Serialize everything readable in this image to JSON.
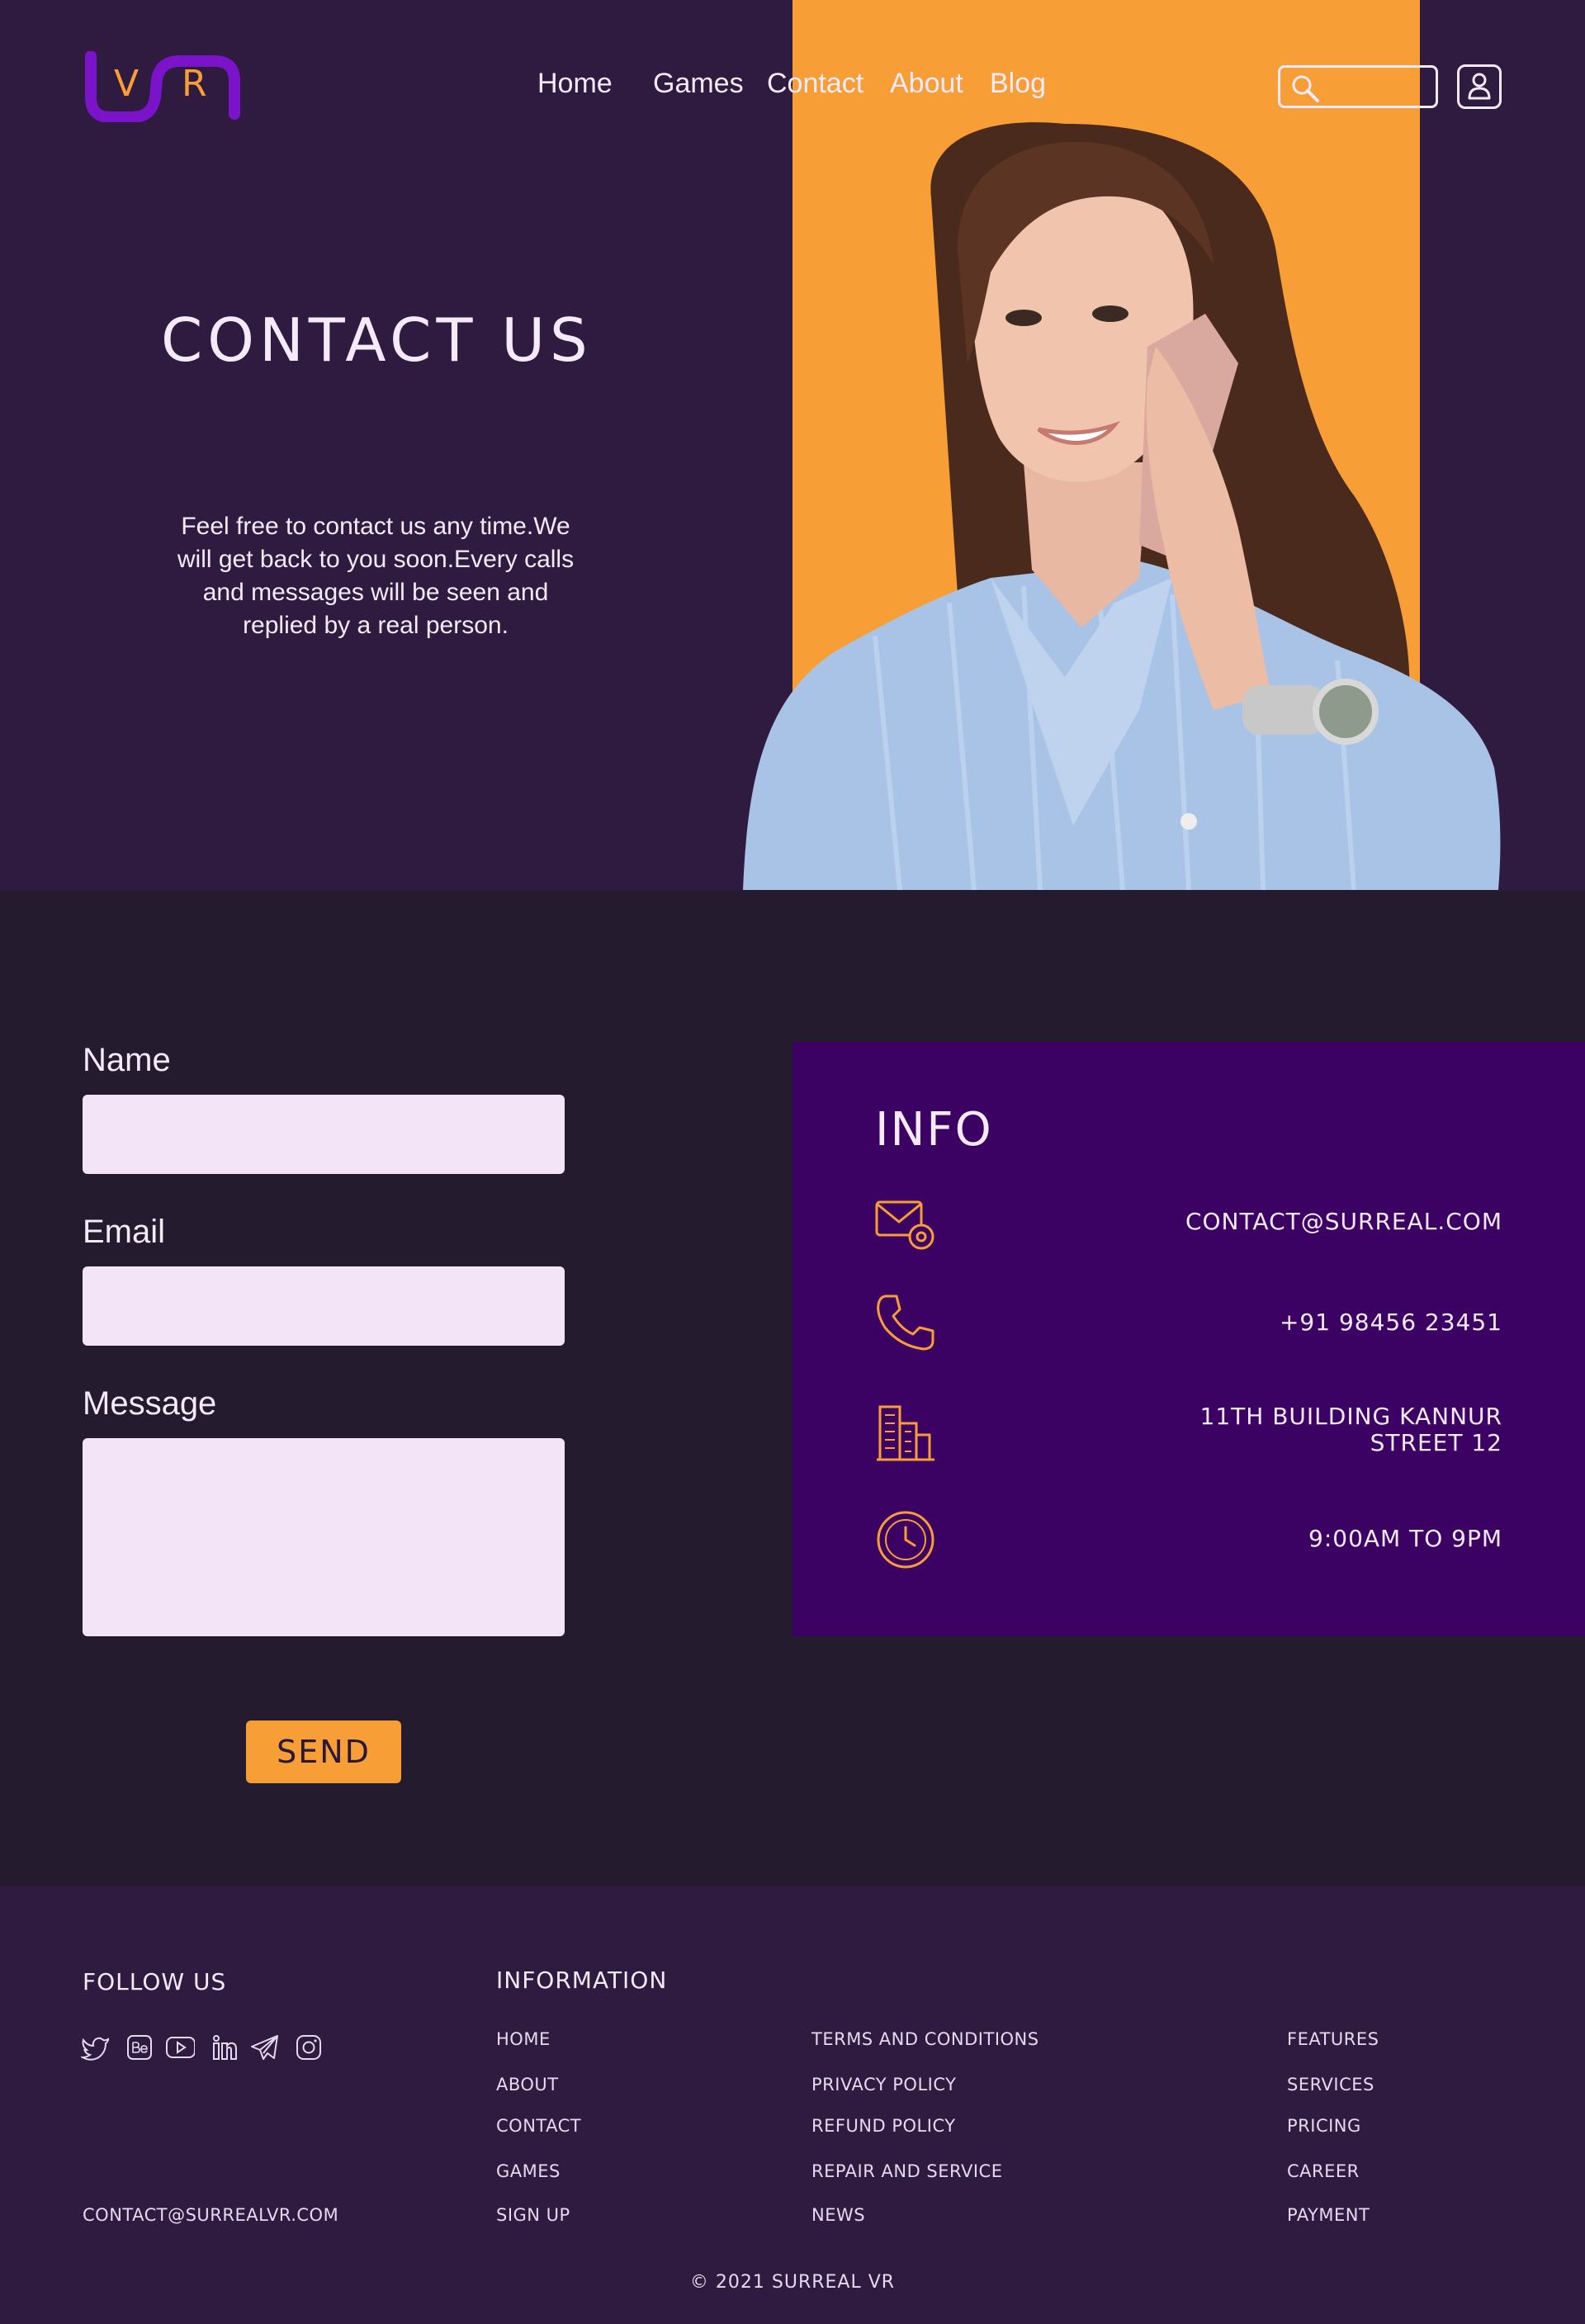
{
  "brand": {
    "letter_1": "V",
    "letter_2": "R",
    "logo_color": "#7a13c9",
    "accent_color": "#f79e36"
  },
  "nav": {
    "home": "Home",
    "games": "Games",
    "contact": "Contact",
    "about": "About",
    "blog": "Blog"
  },
  "search": {
    "placeholder": ""
  },
  "hero": {
    "title": "CONTACT US",
    "text": "Feel free to contact us any time.We will get back to you soon.Every calls and messages will be seen and replied by a real person."
  },
  "form": {
    "name_label": "Name",
    "email_label": "Email",
    "message_label": "Message",
    "send_label": "SEND"
  },
  "info": {
    "title": "INFO",
    "email": "CONTACT@SURREAL.COM",
    "phone": "+91 98456 23451",
    "address_line1": "11TH BUILDING KANNUR",
    "address_line2": "STREET 12",
    "hours": "9:00AM TO 9PM"
  },
  "footer": {
    "follow_title": "FOLLOW US",
    "info_title": "INFORMATION",
    "email": "CONTACT@SURREALVR.COM",
    "col1": [
      "HOME",
      "ABOUT",
      "CONTACT",
      "GAMES",
      "SIGN UP"
    ],
    "col2": [
      "TERMS AND CONDITIONS",
      "PRIVACY POLICY",
      "REFUND POLICY",
      "REPAIR AND SERVICE",
      "NEWS"
    ],
    "col3": [
      "FEATURES",
      "SERVICES",
      "PRICING",
      "CAREER",
      "PAYMENT"
    ],
    "copyright": "© 2021 SURREAL VR"
  },
  "social_icons": [
    "twitter-icon",
    "behance-icon",
    "youtube-icon",
    "linkedin-icon",
    "telegram-icon",
    "instagram-icon"
  ]
}
